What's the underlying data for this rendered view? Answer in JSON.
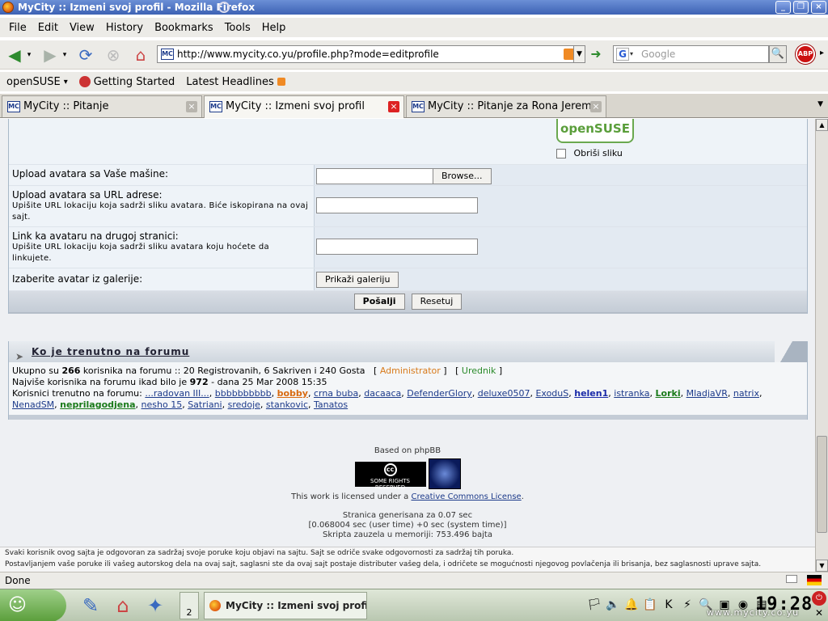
{
  "window": {
    "title": "MyCity :: Izmeni svoj profil - Mozilla Firefox",
    "buttons": [
      "_",
      "❐",
      "×"
    ]
  },
  "menubar": [
    "File",
    "Edit",
    "View",
    "History",
    "Bookmarks",
    "Tools",
    "Help"
  ],
  "nav": {
    "url": "http://www.mycity.co.yu/profile.php?mode=editprofile",
    "url_favicon": "MC",
    "search_placeholder": "Google",
    "search_engine": "G",
    "abp": "ABP"
  },
  "bookmarks": [
    {
      "label": "openSUSE",
      "dropdown": true
    },
    {
      "label": "Getting Started"
    },
    {
      "label": "Latest Headlines",
      "rss": true
    }
  ],
  "tabs": [
    {
      "label": "MyCity :: Pitanje",
      "active": false
    },
    {
      "label": "MyCity :: Izmeni svoj profil",
      "active": true
    },
    {
      "label": "MyCity :: Pitanje za Rona Jeremy",
      "active": false
    }
  ],
  "form": {
    "logo_text": "openSUSE",
    "delete_image_label": "Obriši sliku",
    "rows": [
      {
        "label": "Upload avatara sa Vaše mašine:",
        "button": "Browse..."
      },
      {
        "label": "Upload avatara sa URL adrese:",
        "hint": "Upišite URL lokaciju koja sadrži sliku avatara. Biće iskopirana na ovaj sajt."
      },
      {
        "label": "Link ka avataru na drugoj stranici:",
        "hint": "Upišite URL lokaciju koja sadrži sliku avatara koju hoćete da linkujete."
      },
      {
        "label": "Izaberite avatar iz galerije:",
        "button": "Prikaži galeriju"
      }
    ],
    "submit": "Pošalji",
    "reset": "Resetuj"
  },
  "online": {
    "title": "Ko je trenutno na forumu",
    "line1_pre": "Ukupno su",
    "total": "266",
    "line1_post": "korisnika na forumu :: 20 Registrovanih, 6 Sakriven i 240 Gosta",
    "admin": "Administrator",
    "editor": "Urednik",
    "line2_pre": "Najviše korisnika na forumu ikad bilo je",
    "max": "972",
    "line2_post": "- dana 25 Mar 2008 15:35",
    "line3_label": "Korisnici trenutno na forumu:",
    "users": [
      {
        "name": "...radovan III...",
        "style": ""
      },
      {
        "name": "bbbbbbbbbb",
        "style": ""
      },
      {
        "name": "bobby",
        "style": "ub-orange"
      },
      {
        "name": "crna buba",
        "style": ""
      },
      {
        "name": "dacaaca",
        "style": ""
      },
      {
        "name": "DefenderGlory",
        "style": ""
      },
      {
        "name": "deluxe0507",
        "style": ""
      },
      {
        "name": "ExoduS",
        "style": ""
      },
      {
        "name": "helen1",
        "style": "ub-blue"
      },
      {
        "name": "istranka",
        "style": ""
      },
      {
        "name": "Lorki",
        "style": "ub-green"
      },
      {
        "name": "MladjaVR",
        "style": ""
      },
      {
        "name": "natrix",
        "style": ""
      },
      {
        "name": "NenadSM",
        "style": ""
      },
      {
        "name": "neprilagodjena",
        "style": "ub-green"
      },
      {
        "name": "nesho 15",
        "style": ""
      },
      {
        "name": "Satriani",
        "style": ""
      },
      {
        "name": "sredoje",
        "style": ""
      },
      {
        "name": "stankovic",
        "style": ""
      },
      {
        "name": "Tanatos",
        "style": ""
      }
    ]
  },
  "footer": {
    "based_on": "Based on phpBB",
    "cc_text": "SOME RIGHTS RESERVED",
    "license_pre": "This work is licensed under a",
    "license_link": "Creative Commons License",
    "license_post": ".",
    "gen_time": "Stranica generisana za 0.07 sec",
    "user_time": "[0.068004 sec (user time) +0 sec (system time)]",
    "memory": "Skripta zauzela u memoriji: 753.496 bajta",
    "disclaimer1": "Svaki korisnik ovog sajta je odgovoran za sadržaj svoje poruke koju objavi na sajtu. Sajt se odriče svake odgovornosti za sadržaj tih poruka.",
    "disclaimer2": "Postavljanjem vaše poruke ili vašeg autorskog dela na ovaj sajt, saglasni ste da ovaj sajt postaje distributer vašeg dela, i odričete se mogućnosti njegovog povlačenja ili brisanja, bez saglasnosti uprave sajta."
  },
  "status": {
    "text": "Done"
  },
  "taskbar": {
    "task_title": "MyCity :: Izmeni svoj profil - Mo",
    "task_count": "2",
    "clock": "19:28",
    "watermark": "www.mycity.co.yu"
  }
}
